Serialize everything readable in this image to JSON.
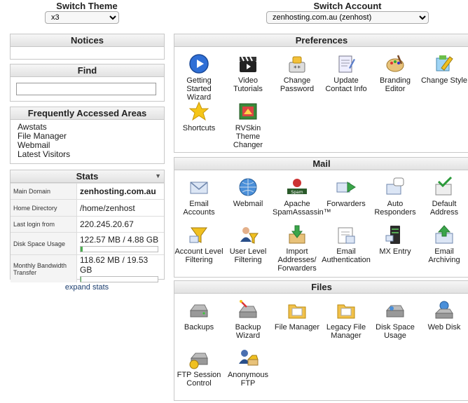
{
  "switch_theme": {
    "label": "Switch Theme",
    "selected": "x3"
  },
  "switch_account": {
    "label": "Switch Account",
    "selected": "zenhosting.com.au (zenhost)"
  },
  "notices": {
    "title": "Notices"
  },
  "find": {
    "title": "Find",
    "value": ""
  },
  "frequent": {
    "title": "Frequently Accessed Areas",
    "links": [
      "Awstats",
      "File Manager",
      "Webmail",
      "Latest Visitors"
    ]
  },
  "stats": {
    "title": "Stats",
    "rows": [
      {
        "label": "Main Domain",
        "value": "zenhosting.com.au"
      },
      {
        "label": "Home Directory",
        "value": "/home/zenhost"
      },
      {
        "label": "Last login from",
        "value": "220.245.20.67"
      },
      {
        "label": "Disk Space Usage",
        "value": "122.57 MB / 4.88 GB",
        "usage_fraction": 0.025
      },
      {
        "label": "Monthly Bandwidth Transfer",
        "value": "118.62 MB / 19.53 GB",
        "usage_fraction": 0.006
      }
    ],
    "expand_label": "expand stats"
  },
  "preferences": {
    "title": "Preferences",
    "items": [
      {
        "label": "Getting Started Wizard",
        "icon": "play-icon"
      },
      {
        "label": "Video Tutorials",
        "icon": "clapperboard-icon"
      },
      {
        "label": "Change Password",
        "icon": "password-icon"
      },
      {
        "label": "Update Contact Info",
        "icon": "contact-icon"
      },
      {
        "label": "Branding Editor",
        "icon": "palette-icon"
      },
      {
        "label": "Change Style",
        "icon": "style-icon"
      },
      {
        "label": "Shortcuts",
        "icon": "star-icon"
      },
      {
        "label": "RVSkin Theme Changer",
        "icon": "theme-icon"
      }
    ]
  },
  "mail": {
    "title": "Mail",
    "items": [
      {
        "label": "Email Accounts",
        "icon": "envelope-icon"
      },
      {
        "label": "Webmail",
        "icon": "globe-mail-icon"
      },
      {
        "label": "Apache SpamAssassin™",
        "icon": "spamassassin-icon"
      },
      {
        "label": "Forwarders",
        "icon": "forward-icon"
      },
      {
        "label": "Auto Responders",
        "icon": "autoresponder-icon"
      },
      {
        "label": "Default Address",
        "icon": "default-address-icon"
      },
      {
        "label": "Account Level Filtering",
        "icon": "filter-icon"
      },
      {
        "label": "User Level Filtering",
        "icon": "user-filter-icon"
      },
      {
        "label": "Import Addresses/ Forwarders",
        "icon": "import-icon"
      },
      {
        "label": "Email Authentication",
        "icon": "auth-icon"
      },
      {
        "label": "MX Entry",
        "icon": "server-icon"
      },
      {
        "label": "Email Archiving",
        "icon": "archive-icon"
      }
    ]
  },
  "files": {
    "title": "Files",
    "items": [
      {
        "label": "Backups",
        "icon": "drive-icon"
      },
      {
        "label": "Backup Wizard",
        "icon": "backup-wizard-icon"
      },
      {
        "label": "File Manager",
        "icon": "folder-icon"
      },
      {
        "label": "Legacy File Manager",
        "icon": "folder-icon"
      },
      {
        "label": "Disk Space Usage",
        "icon": "disk-usage-icon"
      },
      {
        "label": "Web Disk",
        "icon": "web-disk-icon"
      },
      {
        "label": "FTP Session Control",
        "icon": "ftp-session-icon"
      },
      {
        "label": "Anonymous FTP",
        "icon": "anonymous-ftp-icon"
      }
    ]
  }
}
